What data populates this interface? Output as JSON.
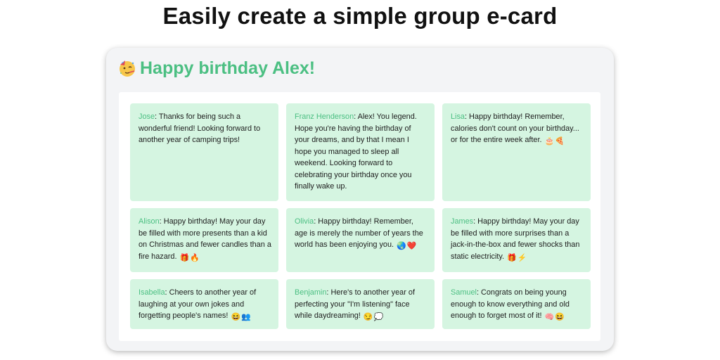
{
  "headline": "Easily create a simple group e-card",
  "card": {
    "title_emoji": "party-face-icon",
    "title": "Happy birthday Alex!"
  },
  "colors": {
    "accent": "#4bbf82",
    "note_background": "#d5f5e1",
    "card_background": "#f3f4f6"
  },
  "messages": [
    {
      "author": "Jose",
      "text": ": Thanks for being such a wonderful friend! Looking forward to another year of camping trips!",
      "emoji": []
    },
    {
      "author": "Franz Henderson",
      "text": ": Alex! You legend. Hope you're having the birthday of your dreams, and by that I mean I hope you managed to sleep all weekend. Looking forward to celebrating your birthday once you finally wake up.",
      "emoji": []
    },
    {
      "author": "Lisa",
      "text": ": Happy birthday! Remember, calories don't count on your birthday... or for the entire week after.",
      "emoji": [
        "cake-icon",
        "pizza-icon"
      ]
    },
    {
      "author": "Alison",
      "text": ": Happy birthday! May your day be filled with more presents than a kid on Christmas and fewer candles than a fire hazard.",
      "emoji": [
        "gift-icon",
        "fire-icon"
      ]
    },
    {
      "author": "Olivia",
      "text": ": Happy birthday! Remember, age is merely the number of years the world has been enjoying you.",
      "emoji": [
        "globe-icon",
        "heart-icon"
      ]
    },
    {
      "author": "James",
      "text": ": Happy birthday! May your day be filled with more surprises than a jack-in-the-box and fewer shocks than static electricity.",
      "emoji": [
        "gift-icon",
        "lightning-icon"
      ]
    },
    {
      "author": "Isabella",
      "text": ": Cheers to another year of laughing at your own jokes and forgetting people's names!",
      "emoji": [
        "laughing-face-icon",
        "people-icon"
      ]
    },
    {
      "author": "Benjamin",
      "text": ": Here's to another year of perfecting your \"I'm listening\" face while daydreaming!",
      "emoji": [
        "smiling-face-icon",
        "thought-bubble-icon"
      ]
    },
    {
      "author": "Samuel",
      "text": ": Congrats on being young enough to know everything and old enough to forget most of it!",
      "emoji": [
        "brain-icon",
        "laughing-face-icon"
      ]
    }
  ]
}
